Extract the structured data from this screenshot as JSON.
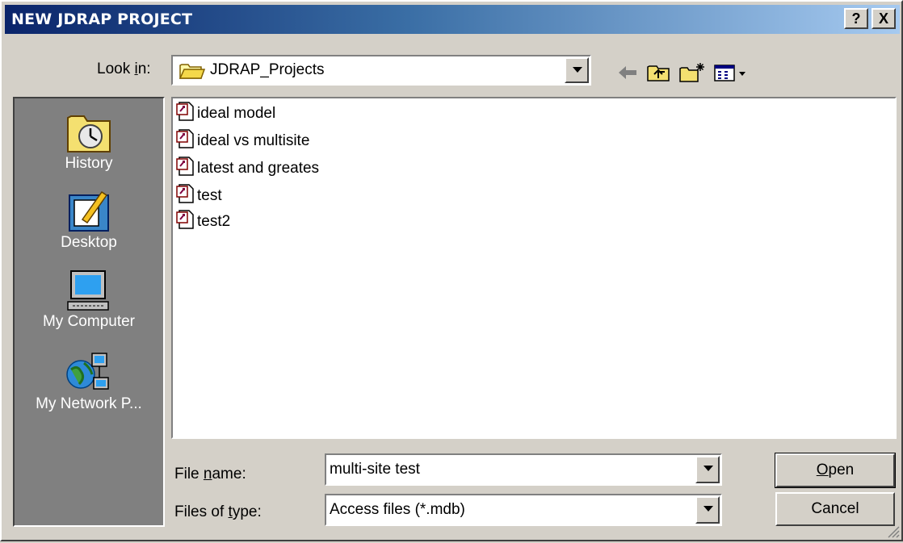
{
  "window": {
    "title": "NEW JDRAP PROJECT",
    "help_label": "?",
    "close_label": "X"
  },
  "lookin": {
    "label_pre": "Look ",
    "label_key": "i",
    "label_post": "n:",
    "value": "JDRAP_Projects"
  },
  "places": [
    {
      "label": "History",
      "icon": "history-icon"
    },
    {
      "label": "Desktop",
      "icon": "desktop-icon"
    },
    {
      "label": "My Computer",
      "icon": "my-computer-icon"
    },
    {
      "label": "My Network P...",
      "icon": "my-network-places-icon"
    }
  ],
  "files": [
    {
      "name": "ideal model"
    },
    {
      "name": "ideal vs multisite"
    },
    {
      "name": "latest and greates"
    },
    {
      "name": "test"
    },
    {
      "name": "test2"
    }
  ],
  "filename": {
    "label_pre": "File ",
    "label_key": "n",
    "label_post": "ame:",
    "value": "multi-site test"
  },
  "filetype": {
    "label_pre": "Files of ",
    "label_key": "t",
    "label_post": "ype:",
    "value": "Access files (*.mdb)"
  },
  "buttons": {
    "open_key": "O",
    "open_rest": "pen",
    "cancel": "Cancel"
  },
  "colors": {
    "title_start": "#0a246a",
    "title_end": "#a6caf0",
    "face": "#d4d0c8",
    "places_bg": "#808080"
  }
}
